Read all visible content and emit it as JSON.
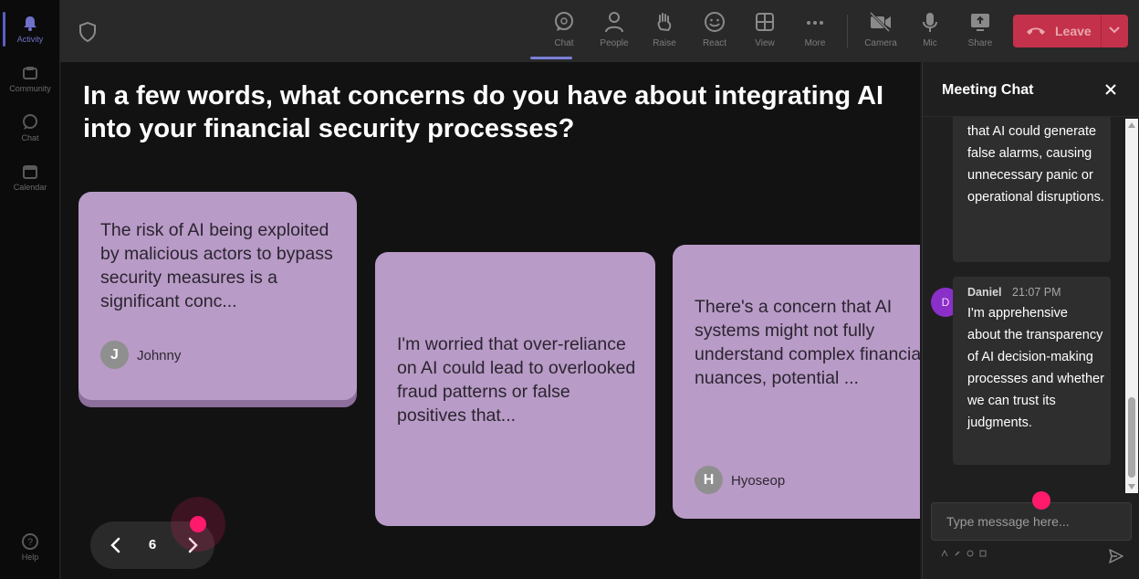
{
  "rail": {
    "items": [
      {
        "label": "Activity",
        "icon": "bell-icon"
      },
      {
        "label": "Community",
        "icon": "community-icon"
      },
      {
        "label": "Chat",
        "icon": "chat-icon"
      },
      {
        "label": "Calendar",
        "icon": "calendar-icon"
      }
    ],
    "help": "Help"
  },
  "toolbar": {
    "chat": "Chat",
    "people": "People",
    "raise": "Raise",
    "react": "React",
    "view": "View",
    "more": "More",
    "camera": "Camera",
    "mic": "Mic",
    "share": "Share",
    "leave": "Leave"
  },
  "stage": {
    "question": "In a few words, what concerns do you have about integrating AI into your financial security processes?",
    "cards": [
      {
        "text": "The risk of AI being exploited by malicious actors to bypass security measures is a significant conc...",
        "initial": "J",
        "author": "Johnny"
      },
      {
        "text": "I'm worried that over-reliance on AI could lead to overlooked fraud patterns or false positives that..."
      },
      {
        "text": "There's a concern that AI systems might not fully understand complex financial nuances, potential ...",
        "initial": "H",
        "author": "Hyoseop"
      }
    ],
    "page": "6"
  },
  "chat": {
    "title": "Meeting Chat",
    "messages": [
      {
        "text": "that AI could generate false alarms, causing unnecessary panic or operational disruptions."
      },
      {
        "avatar": "D",
        "name": "Daniel",
        "time": "21:07 PM",
        "text": "I'm apprehensive about the transparency of AI decision-making processes and whether we can trust its judgments."
      }
    ],
    "placeholder": "Type message here..."
  },
  "colors": {
    "card": "#b89bc6",
    "leave": "#c4314b",
    "accent": "#5b5fc7",
    "cursor": "#ff1a6c",
    "chat_avatar": "#8b2fc9"
  }
}
